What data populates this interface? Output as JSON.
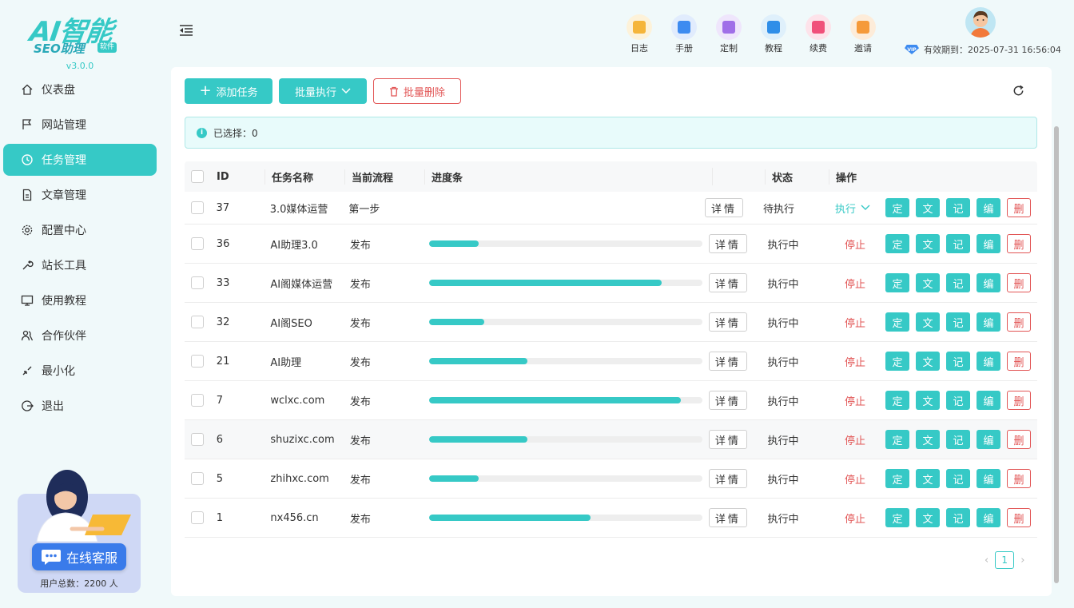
{
  "app": {
    "logo_main": "AI智能",
    "logo_sub": "SEO助理",
    "logo_badge": "软件",
    "version": "v3.0.0"
  },
  "sidebar": {
    "items": [
      {
        "label": "仪表盘",
        "icon": "home-icon",
        "active": false
      },
      {
        "label": "网站管理",
        "icon": "flag-icon",
        "active": false
      },
      {
        "label": "任务管理",
        "icon": "clock-icon",
        "active": true
      },
      {
        "label": "文章管理",
        "icon": "document-icon",
        "active": false
      },
      {
        "label": "配置中心",
        "icon": "gear-icon",
        "active": false
      },
      {
        "label": "站长工具",
        "icon": "wrench-icon",
        "active": false
      },
      {
        "label": "使用教程",
        "icon": "monitor-icon",
        "active": false
      },
      {
        "label": "合作伙伴",
        "icon": "partner-icon",
        "active": false
      },
      {
        "label": "最小化",
        "icon": "minimize-icon",
        "active": false
      },
      {
        "label": "退出",
        "icon": "logout-icon",
        "active": false
      }
    ],
    "support_button": "在线客服",
    "user_count": "用户总数：2200 人"
  },
  "header": {
    "tools": [
      {
        "label": "日志",
        "icon": "log-icon",
        "color": "#f5b53a",
        "bg": "#fdf2d9"
      },
      {
        "label": "手册",
        "icon": "manual-icon",
        "color": "#3d8bf0",
        "bg": "#e1ecfd"
      },
      {
        "label": "定制",
        "icon": "custom-icon",
        "color": "#a06fe8",
        "bg": "#efe6fc"
      },
      {
        "label": "教程",
        "icon": "tutorial-icon",
        "color": "#2f8ee8",
        "bg": "#dff0fb"
      },
      {
        "label": "续费",
        "icon": "renew-icon",
        "color": "#f0507a",
        "bg": "#fde3ea"
      },
      {
        "label": "邀请",
        "icon": "invite-icon",
        "color": "#f59a3a",
        "bg": "#fdecd9"
      }
    ],
    "expiry": "有效期到：2025-07-31 16:56:04",
    "vip_label": "VIP"
  },
  "toolbar": {
    "add_label": "添加任务",
    "batch_label": "批量执行",
    "delete_label": "批量删除"
  },
  "alert": {
    "selected_text": "已选择：0"
  },
  "table": {
    "headers": {
      "id": "ID",
      "name": "任务名称",
      "flow": "当前流程",
      "progress": "进度条",
      "status": "状态",
      "ops": "操作"
    },
    "detail_label": "详情",
    "op_labels": {
      "set": "定",
      "text": "文",
      "log": "记",
      "edit": "编",
      "del": "删"
    },
    "rows": [
      {
        "id": "37",
        "name": "3.0媒体运营",
        "flow": "第一步",
        "progress": null,
        "status": "待执行",
        "action": "执行"
      },
      {
        "id": "36",
        "name": "AI助理3.0",
        "flow": "发布",
        "progress": 0.18,
        "status": "执行中",
        "action": "停止"
      },
      {
        "id": "33",
        "name": "AI阁媒体运营",
        "flow": "发布",
        "progress": 0.85,
        "status": "执行中",
        "action": "停止"
      },
      {
        "id": "32",
        "name": "AI阁SEO",
        "flow": "发布",
        "progress": 0.2,
        "status": "执行中",
        "action": "停止"
      },
      {
        "id": "21",
        "name": "AI助理",
        "flow": "发布",
        "progress": 0.36,
        "status": "执行中",
        "action": "停止"
      },
      {
        "id": "7",
        "name": "wclxc.com",
        "flow": "发布",
        "progress": 0.92,
        "status": "执行中",
        "action": "停止"
      },
      {
        "id": "6",
        "name": "shuzixc.com",
        "flow": "发布",
        "progress": 0.36,
        "status": "执行中",
        "action": "停止"
      },
      {
        "id": "5",
        "name": "zhihxc.com",
        "flow": "发布",
        "progress": 0.18,
        "status": "执行中",
        "action": "停止"
      },
      {
        "id": "1",
        "name": "nx456.cn",
        "flow": "发布",
        "progress": 0.59,
        "status": "执行中",
        "action": "停止"
      }
    ]
  },
  "pagination": {
    "current": "1"
  },
  "colors": {
    "accent": "#36c9c6",
    "danger": "#e25555"
  }
}
